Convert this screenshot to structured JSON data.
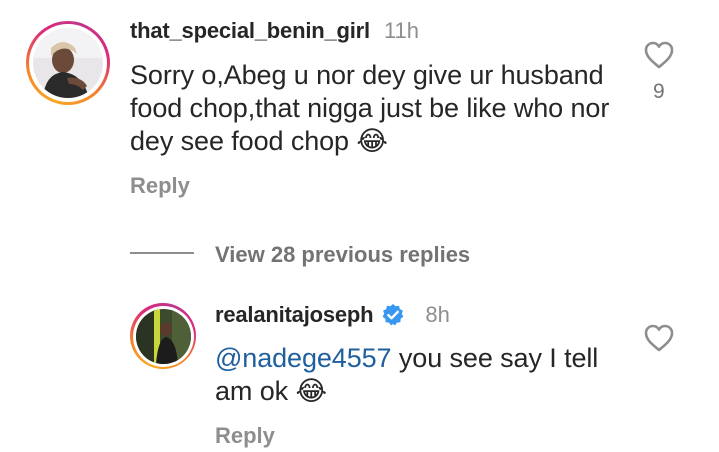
{
  "comment": {
    "username": "that_special_benin_girl",
    "time": "11h",
    "text": "Sorry o,Abeg u nor dey give ur husband food chop,that nigga just be like who nor dey see food chop",
    "emoji": "😂",
    "likes": "9",
    "reply_label": "Reply"
  },
  "view_replies_label": "View 28 previous replies",
  "reply": {
    "username": "realanitajoseph",
    "time": "8h",
    "verified": true,
    "mention": "@nadege4557",
    "text": " you see say I tell am ok",
    "emoji": "😂",
    "reply_label": "Reply"
  },
  "colors": {
    "mention": "#1f5f9e",
    "verified": "#3897f0",
    "muted": "#8e8e8e"
  }
}
